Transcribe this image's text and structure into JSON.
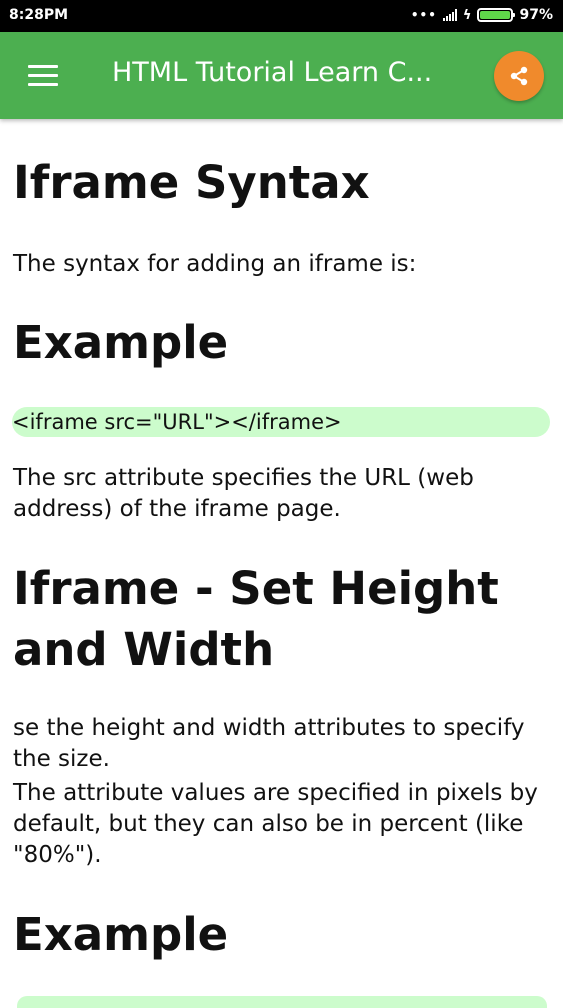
{
  "status_bar": {
    "time": "8:28PM",
    "dots": "•••",
    "battery_percent": "97%",
    "battery_level": 0.97,
    "charging_icon": "bolt-icon"
  },
  "app_bar": {
    "title": "HTML Tutorial Learn C...",
    "menu_icon": "hamburger-menu-icon",
    "share_icon": "share-icon",
    "color": "#4caf50",
    "share_color": "#f08a2c"
  },
  "content": {
    "heading_syntax": "Iframe Syntax",
    "syntax_text": "The syntax for adding an iframe is:",
    "heading_example_1": "Example",
    "code_example_1": "<iframe src=\"URL\"></iframe>",
    "src_text": "The src attribute specifies the URL (web address) of the iframe page.",
    "heading_set_size": "Iframe - Set Height and Width",
    "size_text": "se the height and width attributes to specify the size.",
    "pixels_text": "The attribute values are specified in pixels by default, but they can also be in percent (like \"80%\").",
    "heading_example_2": "Example",
    "code_highlight_color": "#ccfccc"
  }
}
